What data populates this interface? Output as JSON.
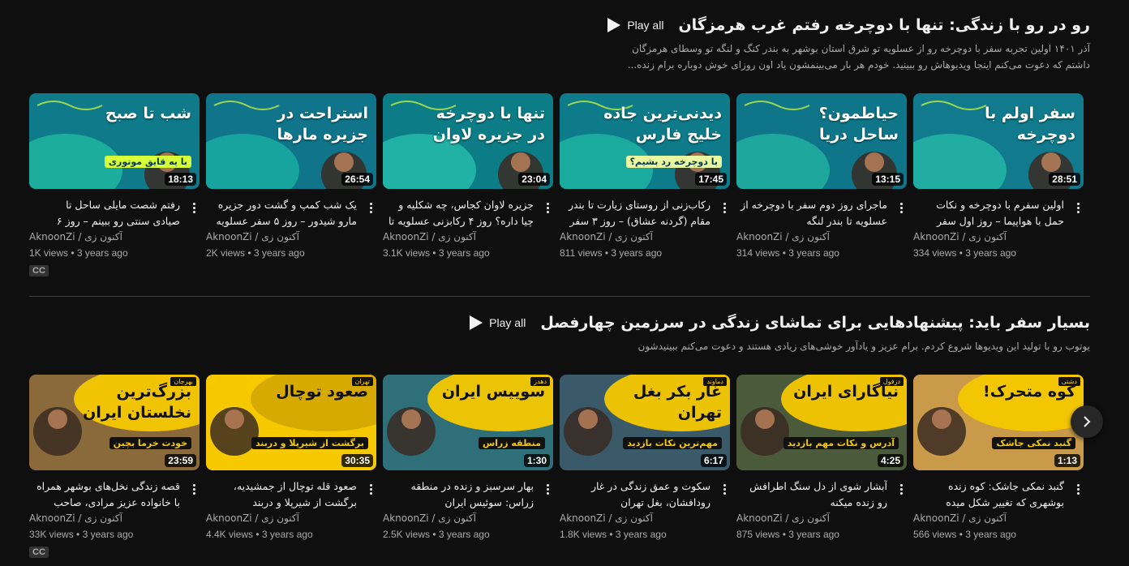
{
  "sections": [
    {
      "title": "رو در رو با زندگی: تنها با دوچرخه رفتم غرب هرمزگان",
      "play_all": "Play all",
      "desc_line1": "آذر ۱۴۰۱ اولین تجربه سفر با دوچرخه رو از عسلویه تو شرق استان بوشهر به بندر کنگ و لنگه تو وسطای هرمزگان",
      "desc_line2": "داشتم که دعوت می‌کنم اینجا ویدیوهاش رو ببینید. خودم هر بار می‌بینمشون یاد اون روزای خوش دوباره برام زنده...",
      "videos": [
        {
          "thumb_text": "شب تا صبح",
          "thumb_sub": "با یه قایق موتوری",
          "duration": "18:13",
          "title_line1": "رفتم شصت مایلی ساحل تا",
          "title_line2": "صیادی سنتی رو ببینم – روز ۶",
          "channel": "AknoonZi / آکنون زی",
          "views": "1K views",
          "age": "3 years ago",
          "cc": "CC",
          "bg": "#0f7a8a",
          "blob": "#1fb39e",
          "accent": "#d7ff3a"
        },
        {
          "thumb_text": "استراحت در جزیره مارها",
          "thumb_sub": "",
          "duration": "26:54",
          "title_line1": "یک شب کمپ و گشت دور جزیره",
          "title_line2": "مارو شیدور – روز ۵ سفر عسلویه",
          "channel": "AknoonZi / آکنون زی",
          "views": "2K views",
          "age": "3 years ago",
          "bg": "#10748a",
          "blob": "#18a8a0",
          "accent": "#e8f7a0"
        },
        {
          "thumb_text": "تنها با دوچرخه در جزیره لاوان",
          "thumb_sub": "",
          "duration": "23:04",
          "title_line1": "جزیره لاوان کجاس، چه شکلیه و",
          "title_line2": "چیا داره؟ روز ۴ رکابزنی عسلویه تا",
          "channel": "AknoonZi / آکنون زی",
          "views": "3.1K views",
          "age": "3 years ago",
          "bg": "#0c7d86",
          "blob": "#23b8a8",
          "accent": "#e8f7a0"
        },
        {
          "thumb_text": "دیدنی‌ترین جاده خلیج فارس",
          "thumb_sub": "با دوچرخه رد بشیم؟",
          "duration": "17:45",
          "title_line1": "رکاب‌زنی از روستای زیارت تا بندر",
          "title_line2": "مقام (گردنه عشاق) – روز ۳ سفر",
          "channel": "AknoonZi / آکنون زی",
          "views": "811 views",
          "age": "3 years ago",
          "bg": "#0e7b8a",
          "blob": "#1db0a0",
          "accent": "#e8f7a0"
        },
        {
          "thumb_text": "حیاطمون؟ ساحل دریا",
          "thumb_sub": "",
          "duration": "13:15",
          "title_line1": "ماجرای روز دوم سفر با دوچرخه از",
          "title_line2": "عسلویه تا بندر لنگه",
          "channel": "AknoonZi / آکنون زی",
          "views": "314 views",
          "age": "3 years ago",
          "bg": "#0f768a",
          "blob": "#20ad9e",
          "accent": "#f0f8c8"
        },
        {
          "thumb_text": "سفر اولم با دوچرخه",
          "thumb_sub": "",
          "duration": "28:51",
          "title_line1": "اولین سفرم با دوچرخه و نکات",
          "title_line2": "حمل با هواپیما – روز اول سفر",
          "channel": "AknoonZi / آکنون زی",
          "views": "334 views",
          "age": "3 years ago",
          "bg": "#117a8c",
          "blob": "#24b3a3",
          "accent": "#f0f8c8"
        }
      ]
    },
    {
      "title": "بسیار سفر باید: پیشنهادهایی برای تماشای زندگی در سرزمین چهارفصل",
      "play_all": "Play all",
      "desc_line1": "یوتوب رو با تولید این ویدیوها شروع کردم. برام عزیز و یادآور خوشی‌های زیادی هستند و دعوت می‌کنم ببینیدشون",
      "desc_line2": "",
      "videos": [
        {
          "thumb_text": "بزرگ‌ترین نخلستان ایران",
          "thumb_sub": "خودت خرما بچین",
          "region": "بهرجان",
          "duration": "23:59",
          "title_line1": "قصه زندگی نخل‌های بوشهر همراه",
          "title_line2": "با خانواده عزیز مرادی، صاحب",
          "channel": "AknoonZi / آکنون زی",
          "views": "33K views",
          "age": "3 years ago",
          "cc": "CC",
          "bg": "#8a6a3a",
          "blob": "#f5c800",
          "accent": "#111111"
        },
        {
          "thumb_text": "صعود توچال",
          "thumb_sub": "برگشت از شیرپلا و دربند",
          "region": "تهران",
          "duration": "30:35",
          "title_line1": "صعود قله توچال از جمشیدیه،",
          "title_line2": "برگشت از شیرپلا و دربند",
          "channel": "AknoonZi / آکنون زی",
          "views": "4.4K views",
          "age": "3 years ago",
          "bg": "#f5c800",
          "blob": "#d4a900",
          "accent": "#111111"
        },
        {
          "thumb_text": "سوییس ایران",
          "thumb_sub": "منطقه زراس",
          "region": "دهدز",
          "duration": "1:30",
          "title_line1": "بهار سرسبز و زنده در منطقه",
          "title_line2": "زراس: سوئیس ایران",
          "channel": "AknoonZi / آکنون زی",
          "views": "2.5K views",
          "age": "3 years ago",
          "bg": "#2f6f7a",
          "blob": "#f5c800",
          "accent": "#111111"
        },
        {
          "thumb_text": "غار بکر بغل تهران",
          "thumb_sub": "مهم‌ترین نکات بازدید",
          "region": "دماوند",
          "duration": "6:17",
          "title_line1": "سکوت و عمق زندگی در غار",
          "title_line2": "رودافشان، بغل تهران",
          "channel": "AknoonZi / آکنون زی",
          "views": "1.8K views",
          "age": "3 years ago",
          "bg": "#3a5a6a",
          "blob": "#f5c800",
          "accent": "#111111"
        },
        {
          "thumb_text": "نیاگارای ایران",
          "thumb_sub": "آدرس و نکات مهم بازدید",
          "region": "دزفول",
          "duration": "4:25",
          "title_line1": "آبشار شوی از دل سنگ اطرافش",
          "title_line2": "رو زنده میکنه",
          "channel": "AknoonZi / آکنون زی",
          "views": "875 views",
          "age": "3 years ago",
          "bg": "#4a5a3a",
          "blob": "#f5c800",
          "accent": "#111111"
        },
        {
          "thumb_text": "کوه متحرک!",
          "thumb_sub": "گنبد نمکی جاشک",
          "region": "دشتی",
          "duration": "1:13",
          "title_line1": "گنبد نمکی جاشک: کوه زنده",
          "title_line2": "بوشهری که تغییر شکل میده",
          "channel": "AknoonZi / آکنون زی",
          "views": "566 views",
          "age": "3 years ago",
          "bg": "#c89a4a",
          "blob": "#f5c800",
          "accent": "#111111"
        }
      ]
    }
  ],
  "next_icon": "chevron-right-icon"
}
